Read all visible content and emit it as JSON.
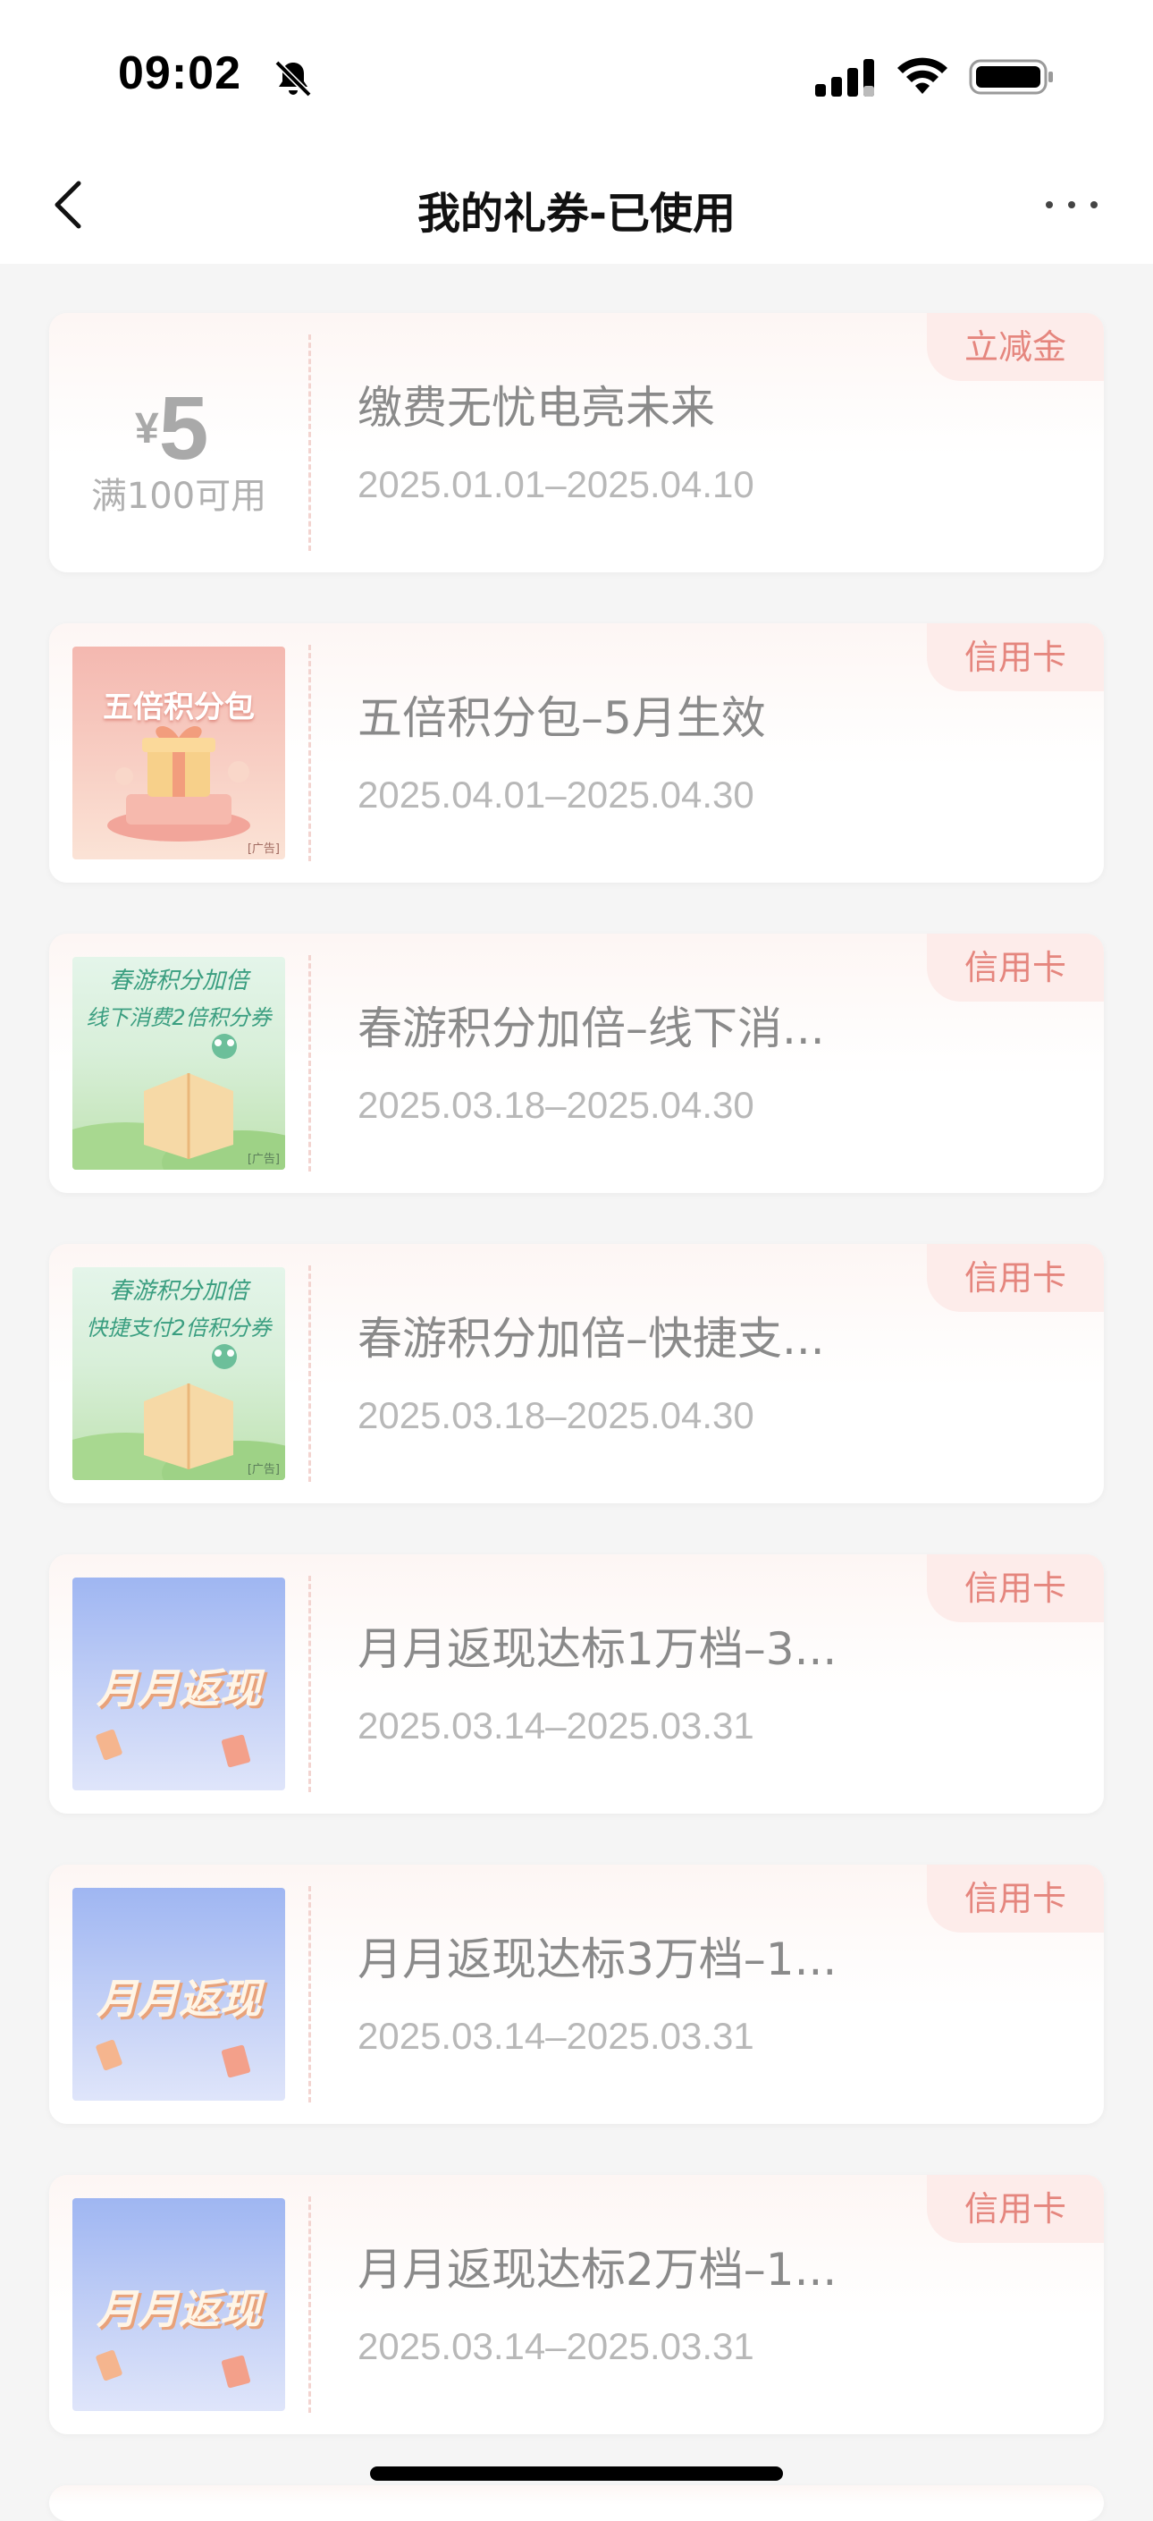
{
  "status_bar": {
    "time": "09:02"
  },
  "header": {
    "title": "我的礼券-已使用"
  },
  "coupons": [
    {
      "tag": "立减金",
      "name": "缴费无忧电亮未来",
      "dates": "2025.01.01–2025.04.10",
      "currency": "¥",
      "amount": "5",
      "condition": "满100可用"
    },
    {
      "tag": "信用卡",
      "name": "五倍积分包–5月生效",
      "dates": "2025.04.01–2025.04.30",
      "thumb_text": "五倍积分包",
      "thumb_small": "[广告]"
    },
    {
      "tag": "信用卡",
      "name": "春游积分加倍–线下消...",
      "dates": "2025.03.18–2025.04.30",
      "thumb_text": "春游积分加倍",
      "thumb_line2": "线下消费2倍积分券",
      "thumb_small": "[广告]"
    },
    {
      "tag": "信用卡",
      "name": "春游积分加倍–快捷支...",
      "dates": "2025.03.18–2025.04.30",
      "thumb_text": "春游积分加倍",
      "thumb_line2": "快捷支付2倍积分券",
      "thumb_small": "[广告]"
    },
    {
      "tag": "信用卡",
      "name": "月月返现达标1万档–3...",
      "dates": "2025.03.14–2025.03.31",
      "thumb_text": "月月返现"
    },
    {
      "tag": "信用卡",
      "name": "月月返现达标3万档–1...",
      "dates": "2025.03.14–2025.03.31",
      "thumb_text": "月月返现"
    },
    {
      "tag": "信用卡",
      "name": "月月返现达标2万档–1...",
      "dates": "2025.03.14–2025.03.31",
      "thumb_text": "月月返现"
    }
  ],
  "colors": {
    "tag_text": "#e5867e",
    "tag_bg": "#fdecea",
    "page_bg": "#f5f5f5"
  }
}
